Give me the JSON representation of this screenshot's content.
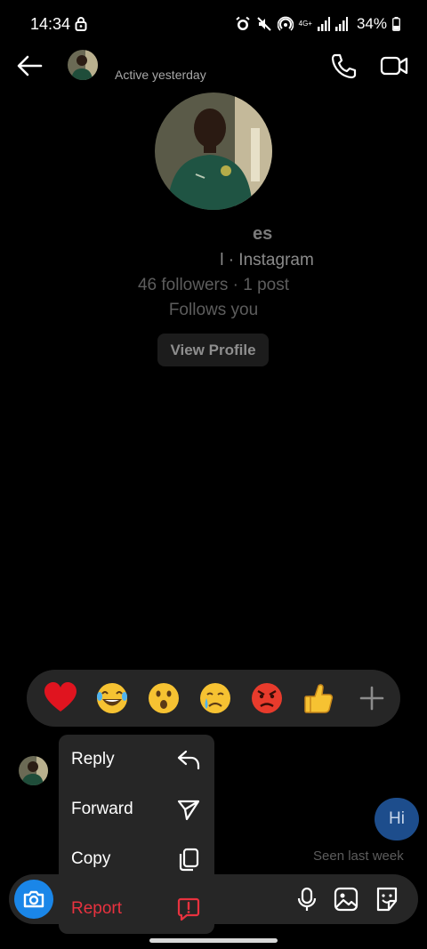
{
  "status_bar": {
    "time": "14:34",
    "network": "4G+",
    "battery": "34%"
  },
  "header": {
    "status": "Active yesterday"
  },
  "profile": {
    "name": "es",
    "username_prefix": "l",
    "platform": " · Instagram",
    "stats": "46 followers · 1 post",
    "follows": "Follows you",
    "view_profile_label": "View Profile"
  },
  "reactions": {
    "emojis": [
      "❤️",
      "😂",
      "😮",
      "😢",
      "😡",
      "👍"
    ]
  },
  "messages": {
    "sent_text": "Hi",
    "seen_text": "Seen last week"
  },
  "context_menu": {
    "reply": "Reply",
    "forward": "Forward",
    "copy": "Copy",
    "report": "Report"
  },
  "colors": {
    "background": "#000000",
    "surface": "#262626",
    "accent_blue": "#1a86e8",
    "bubble_blue": "#1d4d8c",
    "report_red": "#e8323f"
  }
}
